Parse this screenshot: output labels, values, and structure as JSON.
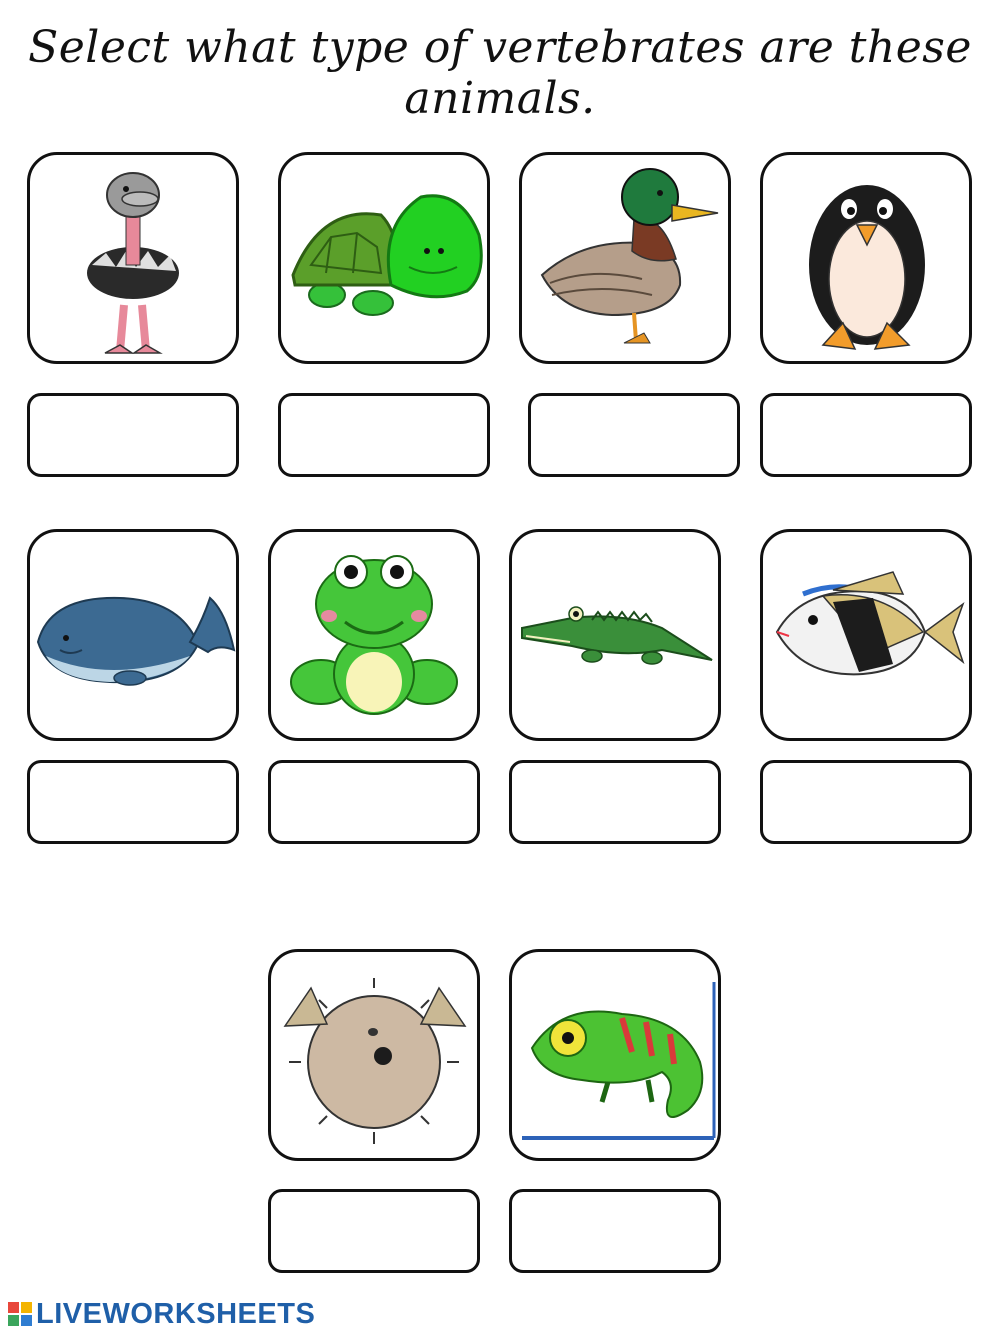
{
  "worksheet": {
    "instruction": "Select what type of vertebrates are these animals."
  },
  "cards": [
    {
      "animal": "ostrich",
      "answer": ""
    },
    {
      "animal": "turtle",
      "answer": ""
    },
    {
      "animal": "duck",
      "answer": ""
    },
    {
      "animal": "penguin",
      "answer": ""
    },
    {
      "animal": "whale",
      "answer": ""
    },
    {
      "animal": "frog",
      "answer": ""
    },
    {
      "animal": "crocodile",
      "answer": ""
    },
    {
      "animal": "fish",
      "answer": ""
    },
    {
      "animal": "pufferfish",
      "answer": ""
    },
    {
      "animal": "chameleon",
      "answer": ""
    }
  ],
  "footer": {
    "brand": "LIVEWORKSHEETS",
    "logo_colors": [
      "#e8473b",
      "#f4b400",
      "#3ba55c",
      "#2f7dd1"
    ]
  }
}
